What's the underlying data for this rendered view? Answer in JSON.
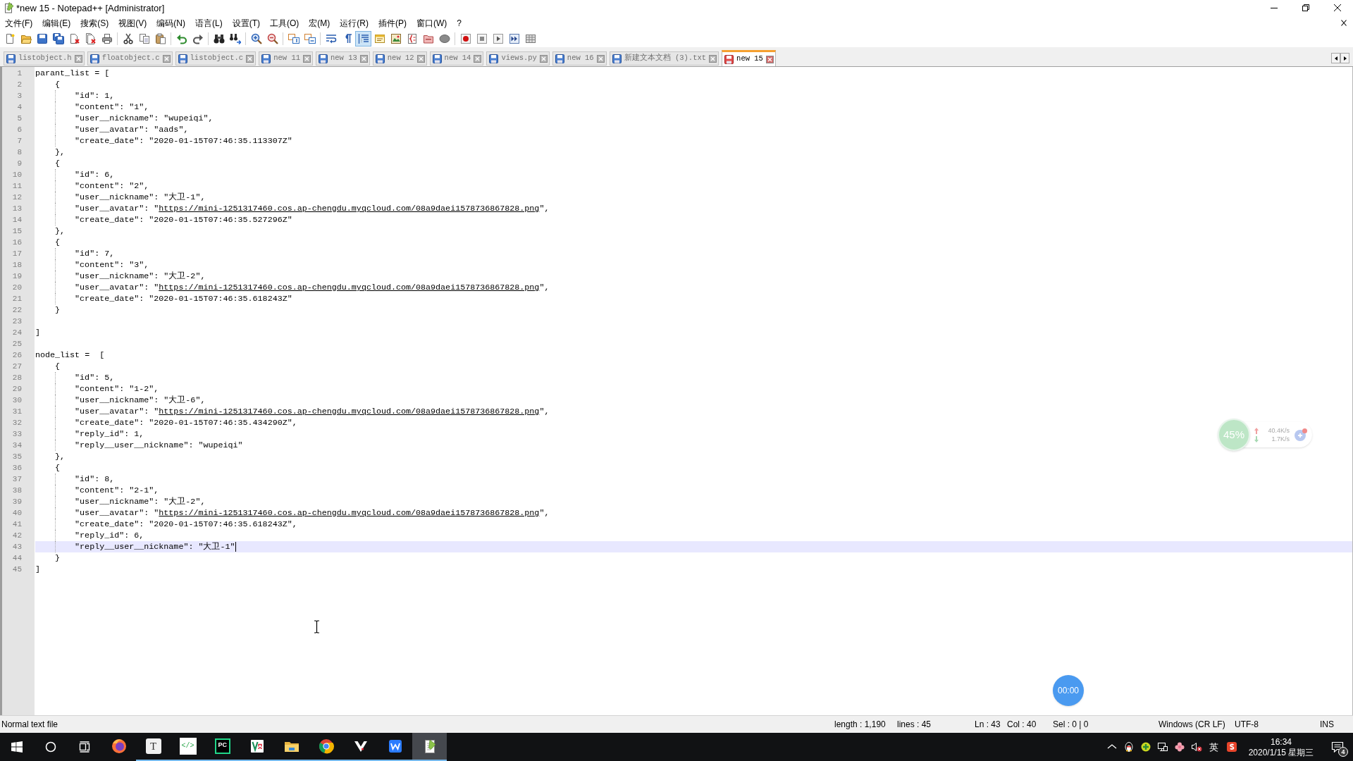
{
  "window": {
    "title": "*new 15 - Notepad++ [Administrator]"
  },
  "menu": [
    "文件(F)",
    "编辑(E)",
    "搜索(S)",
    "视图(V)",
    "编码(N)",
    "语言(L)",
    "设置(T)",
    "工具(O)",
    "宏(M)",
    "运行(R)",
    "插件(P)",
    "窗口(W)",
    "?"
  ],
  "toolbar": [
    {
      "buttons": [
        {
          "kind": "new",
          "pressed": false
        },
        {
          "kind": "open",
          "pressed": false
        },
        {
          "kind": "save",
          "pressed": false
        },
        {
          "kind": "saveall",
          "pressed": false
        },
        {
          "kind": "close",
          "pressed": false
        },
        {
          "kind": "closeall",
          "pressed": false
        },
        {
          "kind": "print",
          "pressed": false
        }
      ]
    },
    {
      "buttons": [
        {
          "kind": "cut",
          "pressed": false
        },
        {
          "kind": "copy",
          "pressed": false
        },
        {
          "kind": "paste",
          "pressed": false
        }
      ]
    },
    {
      "buttons": [
        {
          "kind": "undo",
          "pressed": false
        },
        {
          "kind": "redo",
          "pressed": false
        }
      ]
    },
    {
      "buttons": [
        {
          "kind": "find",
          "pressed": false
        },
        {
          "kind": "replace",
          "pressed": false
        }
      ]
    },
    {
      "buttons": [
        {
          "kind": "zoomin",
          "pressed": false
        },
        {
          "kind": "zoomout",
          "pressed": false
        }
      ]
    },
    {
      "buttons": [
        {
          "kind": "syncv",
          "pressed": false
        },
        {
          "kind": "synch",
          "pressed": false
        }
      ]
    },
    {
      "buttons": [
        {
          "kind": "wrap",
          "pressed": false
        },
        {
          "kind": "allchars",
          "pressed": false
        },
        {
          "kind": "indent",
          "pressed": true
        },
        {
          "kind": "udl",
          "pressed": false
        },
        {
          "kind": "docmap",
          "pressed": false
        },
        {
          "kind": "funclist",
          "pressed": false
        },
        {
          "kind": "workspace",
          "pressed": false
        },
        {
          "kind": "monitor",
          "pressed": false
        }
      ]
    },
    {
      "buttons": [
        {
          "kind": "record",
          "pressed": false
        },
        {
          "kind": "stop",
          "pressed": false
        },
        {
          "kind": "play",
          "pressed": false
        },
        {
          "kind": "playmulti",
          "pressed": false
        },
        {
          "kind": "savemacro",
          "pressed": false
        }
      ]
    }
  ],
  "tabs": [
    {
      "label": "listobject.h",
      "selected": false,
      "modified": false
    },
    {
      "label": "floatobject.c",
      "selected": false,
      "modified": false
    },
    {
      "label": "listobject.c",
      "selected": false,
      "modified": false
    },
    {
      "label": "new 11",
      "selected": false,
      "modified": false
    },
    {
      "label": "new 13",
      "selected": false,
      "modified": false
    },
    {
      "label": "new 12",
      "selected": false,
      "modified": false
    },
    {
      "label": "new 14",
      "selected": false,
      "modified": false
    },
    {
      "label": "views.py",
      "selected": false,
      "modified": false
    },
    {
      "label": "new 16",
      "selected": false,
      "modified": false
    },
    {
      "label": "新建文本文档 (3).txt",
      "selected": false,
      "modified": false
    },
    {
      "label": "new 15",
      "selected": true,
      "modified": true
    }
  ],
  "editor": {
    "lines": [
      {
        "number": "1",
        "text": "parant_list = [",
        "current": false
      },
      {
        "number": "2",
        "text": "    {",
        "current": false
      },
      {
        "number": "3",
        "text": "        \"id\": 1,",
        "current": false
      },
      {
        "number": "4",
        "text": "        \"content\": \"1\",",
        "current": false
      },
      {
        "number": "5",
        "text": "        \"user__nickname\": \"wupeiqi\",",
        "current": false
      },
      {
        "number": "6",
        "text": "        \"user__avatar\": \"aads\",",
        "current": false
      },
      {
        "number": "7",
        "text": "        \"create_date\": \"2020-01-15T07:46:35.113307Z\"",
        "current": false
      },
      {
        "number": "8",
        "text": "    },",
        "current": false
      },
      {
        "number": "9",
        "text": "    {",
        "current": false
      },
      {
        "number": "10",
        "text": "        \"id\": 6,",
        "current": false
      },
      {
        "number": "11",
        "text": "        \"content\": \"2\",",
        "current": false
      },
      {
        "number": "12",
        "text": "        \"user__nickname\": \"大卫-1\",",
        "current": false
      },
      {
        "number": "13",
        "text": "        \"user__avatar\": \"",
        "link": "https://mini-1251317460.cos.ap-chengdu.myqcloud.com/08a9daei1578736867828.png",
        "tail": "\",",
        "current": false
      },
      {
        "number": "14",
        "text": "        \"create_date\": \"2020-01-15T07:46:35.527296Z\"",
        "current": false
      },
      {
        "number": "15",
        "text": "    },",
        "current": false
      },
      {
        "number": "16",
        "text": "    {",
        "current": false
      },
      {
        "number": "17",
        "text": "        \"id\": 7,",
        "current": false
      },
      {
        "number": "18",
        "text": "        \"content\": \"3\",",
        "current": false
      },
      {
        "number": "19",
        "text": "        \"user__nickname\": \"大卫-2\",",
        "current": false
      },
      {
        "number": "20",
        "text": "        \"user__avatar\": \"",
        "link": "https://mini-1251317460.cos.ap-chengdu.myqcloud.com/08a9daei1578736867828.png",
        "tail": "\",",
        "current": false
      },
      {
        "number": "21",
        "text": "        \"create_date\": \"2020-01-15T07:46:35.618243Z\"",
        "current": false
      },
      {
        "number": "22",
        "text": "    }",
        "current": false
      },
      {
        "number": "23",
        "current": false
      },
      {
        "number": "24",
        "text": "]",
        "current": false
      },
      {
        "number": "25",
        "current": false
      },
      {
        "number": "26",
        "text": "node_list =  [",
        "current": false
      },
      {
        "number": "27",
        "text": "    {",
        "current": false
      },
      {
        "number": "28",
        "text": "        \"id\": 5,",
        "current": false
      },
      {
        "number": "29",
        "text": "        \"content\": \"1-2\",",
        "current": false
      },
      {
        "number": "30",
        "text": "        \"user__nickname\": \"大卫-6\",",
        "current": false
      },
      {
        "number": "31",
        "text": "        \"user__avatar\": \"",
        "link": "https://mini-1251317460.cos.ap-chengdu.myqcloud.com/08a9daei1578736867828.png",
        "tail": "\",",
        "current": false
      },
      {
        "number": "32",
        "text": "        \"create_date\": \"2020-01-15T07:46:35.434290Z\",",
        "current": false
      },
      {
        "number": "33",
        "text": "        \"reply_id\": 1,",
        "current": false
      },
      {
        "number": "34",
        "text": "        \"reply__user__nickname\": \"wupeiqi\"",
        "current": false
      },
      {
        "number": "35",
        "text": "    },",
        "current": false
      },
      {
        "number": "36",
        "text": "    {",
        "current": false
      },
      {
        "number": "37",
        "text": "        \"id\": 8,",
        "current": false
      },
      {
        "number": "38",
        "text": "        \"content\": \"2-1\",",
        "current": false
      },
      {
        "number": "39",
        "text": "        \"user__nickname\": \"大卫-2\",",
        "current": false
      },
      {
        "number": "40",
        "text": "        \"user__avatar\": \"",
        "link": "https://mini-1251317460.cos.ap-chengdu.myqcloud.com/08a9daei1578736867828.png",
        "tail": "\",",
        "current": false
      },
      {
        "number": "41",
        "text": "        \"create_date\": \"2020-01-15T07:46:35.618243Z\",",
        "current": false
      },
      {
        "number": "42",
        "text": "        \"reply_id\": 6,",
        "current": false
      },
      {
        "number": "43",
        "text": "        \"reply__user__nickname\": \"大卫-1\"",
        "current": true
      },
      {
        "number": "44",
        "text": "    }",
        "current": false
      },
      {
        "number": "45",
        "text": "]",
        "current": false
      }
    ]
  },
  "status_bar": {
    "file_type": "Normal text file",
    "length": "length : 1,190",
    "lines": "lines : 45",
    "ln": "Ln : 43",
    "col": "Col : 40",
    "sel": "Sel : 0 | 0",
    "eol": "Windows (CR LF)",
    "encoding": "UTF-8",
    "mode": "INS"
  },
  "overlays": {
    "speed_widget": {
      "usage": "45%",
      "upload": "40.4K/s",
      "download": "1.7K/s"
    },
    "timer": "00:00"
  },
  "taskbar": {
    "apps": [
      {
        "kind": "firefox",
        "running": false,
        "active": false
      },
      {
        "kind": "typora",
        "glyph": "T",
        "running": true,
        "active": false
      },
      {
        "kind": "devtool",
        "glyph": "</>",
        "running": true,
        "active": false
      },
      {
        "kind": "pycharm",
        "glyph": "PC",
        "running": true,
        "active": false
      },
      {
        "kind": "vapp",
        "running": true,
        "active": false
      },
      {
        "kind": "explorer",
        "running": true,
        "active": false
      },
      {
        "kind": "chrome",
        "running": true,
        "active": false
      },
      {
        "kind": "vim",
        "running": true,
        "active": false
      },
      {
        "kind": "wps",
        "running": true,
        "active": false
      },
      {
        "kind": "notepadpp",
        "running": true,
        "active": true
      }
    ],
    "tray": {
      "ime": "英",
      "time": "16:34",
      "date": "2020/1/15 星期三",
      "notifications": "4"
    }
  }
}
